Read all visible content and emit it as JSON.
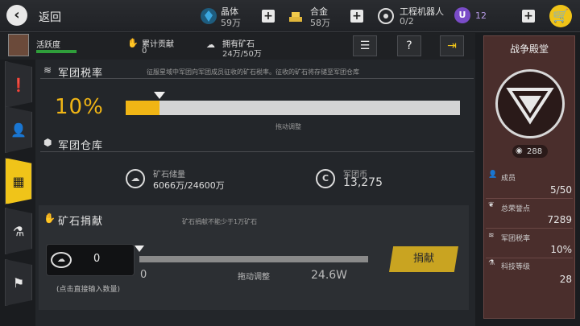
{
  "header": {
    "back_label": "返回",
    "resources": [
      {
        "name": "晶体",
        "value": "59万",
        "icon": "crystal-icon",
        "color": "#3ba7e0"
      },
      {
        "name": "合金",
        "value": "58万",
        "icon": "alloy-bars-icon",
        "color": "#e0b63b"
      },
      {
        "name": "工程机器人",
        "value": "0/2",
        "icon": "robot-icon"
      },
      {
        "name": "",
        "value": "12",
        "icon": "uranium-icon",
        "color": "#7a4cc8"
      }
    ]
  },
  "subbar": {
    "activity_label": "活跃度",
    "contribution_label": "累计贡献",
    "contribution_value": "0",
    "ore_label": "拥有矿石",
    "ore_value": "24万/50万"
  },
  "tax": {
    "title": "军团税率",
    "description": "征服星域中军团向军团成员征收的矿石税率。征收的矿石将存储至军团仓库",
    "value": "10%",
    "fraction": 0.1,
    "slider_hint": "拖动调整"
  },
  "warehouse": {
    "title": "军团仓库",
    "ore_storage_label": "矿石储量",
    "ore_storage_value": "6066万/24600万",
    "coin_label": "军团币",
    "coin_value": "13,275"
  },
  "donate": {
    "title": "矿石捐献",
    "description": "矿石捐献不能少于1万矿石",
    "input_value": "0",
    "input_hint": "(点击直接输入数量)",
    "slider_min": "0",
    "slider_hint": "拖动调整",
    "slider_max": "24.6W",
    "button_label": "捐献"
  },
  "hall": {
    "title": "战争殿堂",
    "badge_value": "288",
    "stats": [
      {
        "label": "成员",
        "value": "5/50"
      },
      {
        "label": "总荣誉点",
        "value": "7289"
      },
      {
        "label": "军团税率",
        "value": "10%"
      },
      {
        "label": "科技等级",
        "value": "28"
      }
    ]
  }
}
